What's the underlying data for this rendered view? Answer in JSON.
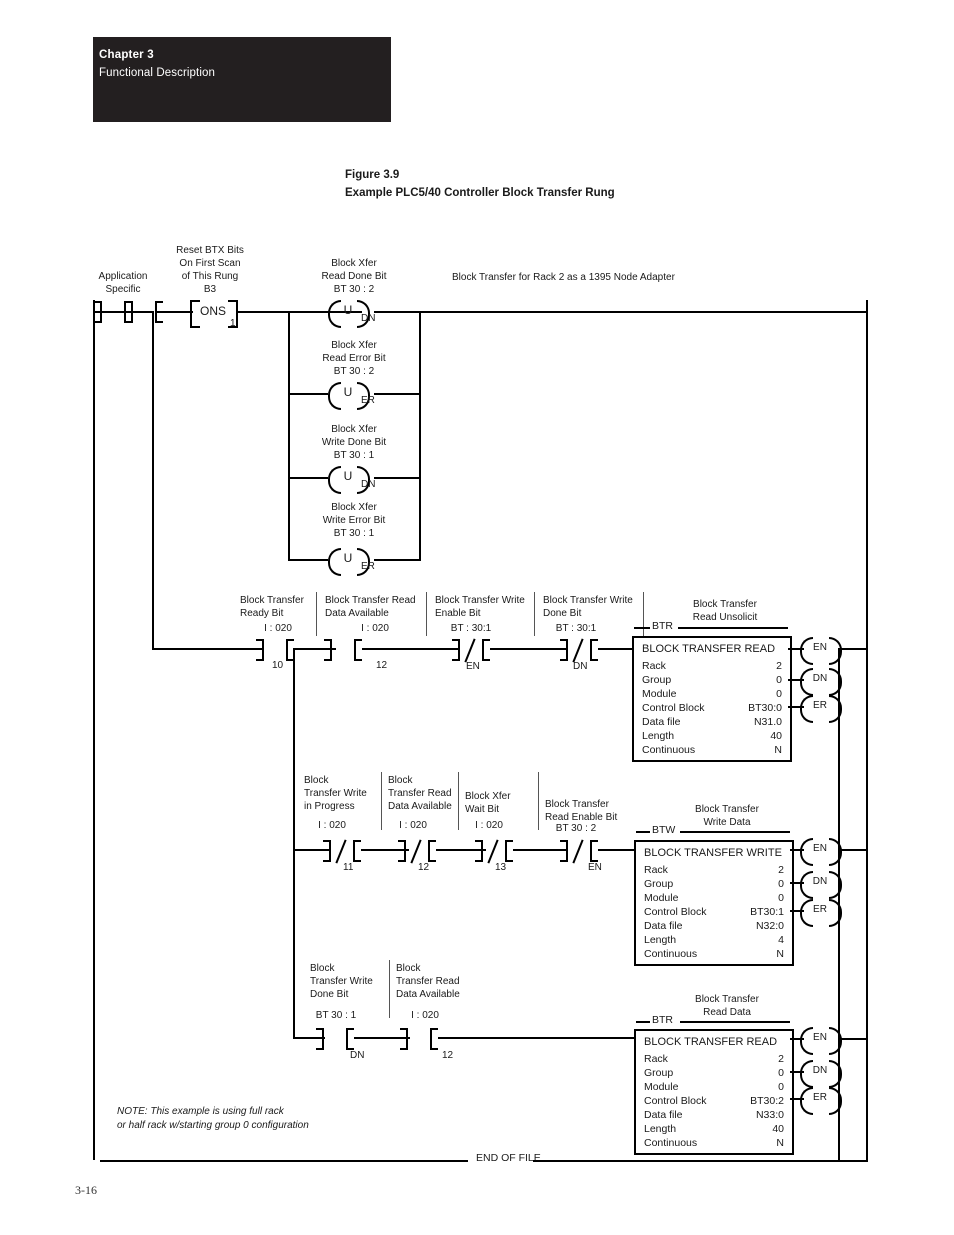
{
  "header": {
    "chapter": "Chapter 3",
    "subtitle": "Functional Description"
  },
  "figure": {
    "number": "Figure 3.9",
    "title": "Example PLC5/40 Controller Block Transfer Rung"
  },
  "page_number": "3-16",
  "note": {
    "line1": "NOTE: This example is using full rack",
    "line2": "or half rack w/starting group 0 configuration"
  },
  "end_of_file": "END OF FILE",
  "rung1": {
    "comment": "Block Transfer for Rack 2 as a 1395 Node Adapter",
    "contact1": {
      "label_line1": "Application",
      "label_line2": "Specific",
      "type": "xic"
    },
    "contact2": {
      "label_line1": "Reset BTX Bits",
      "label_line2": "On First Scan",
      "label_line3": "of This Rung",
      "address": "B3",
      "bit": "1",
      "type": "xic"
    },
    "ons": {
      "label": "ONS"
    },
    "coils": [
      {
        "comment_line1": "Block Xfer",
        "comment_line2": "Read Done Bit",
        "address": "BT 30 : 2",
        "letter": "U",
        "tag": "DN"
      },
      {
        "comment_line1": "Block Xfer",
        "comment_line2": "Read Error Bit",
        "address": "BT 30 : 2",
        "letter": "U",
        "tag": "ER"
      },
      {
        "comment_line1": "Block Xfer",
        "comment_line2": "Write Done Bit",
        "address": "BT 30 : 1",
        "letter": "U",
        "tag": "DN"
      },
      {
        "comment_line1": "Block Xfer",
        "comment_line2": "Write Error Bit",
        "address": "BT 30 : 1",
        "letter": "U",
        "tag": "ER"
      }
    ]
  },
  "rung2": {
    "contacts": [
      {
        "label_line1": "Block Transfer",
        "label_line2": "Ready Bit",
        "address": "I : 020",
        "bit": "10",
        "type": "xic"
      },
      {
        "label_line1": "Block Transfer Read",
        "label_line2": "Data Available",
        "address": "I : 020",
        "bit": "12",
        "type": "xic"
      },
      {
        "label_line1": "Block Transfer Write",
        "label_line2": "Enable Bit",
        "address": "BT : 30:1",
        "bit": "EN",
        "type": "xio"
      },
      {
        "label_line1": "Block Transfer Write",
        "label_line2": "Done Bit",
        "address": "BT : 30:1",
        "bit": "DN",
        "type": "xio"
      }
    ],
    "block": {
      "tag": "BTR",
      "comment_line1": "Block Transfer",
      "comment_line2": "Read Unsolicit",
      "title": "BLOCK TRANSFER READ",
      "rows": [
        {
          "label": "Rack",
          "value": "2"
        },
        {
          "label": "Group",
          "value": "0"
        },
        {
          "label": "Module",
          "value": "0"
        },
        {
          "label": "Control Block",
          "value": "BT30:0"
        },
        {
          "label": "Data file",
          "value": "N31.0"
        },
        {
          "label": "Length",
          "value": "40"
        },
        {
          "label": "Continuous",
          "value": "N"
        }
      ],
      "outputs": [
        "EN",
        "DN",
        "ER"
      ]
    }
  },
  "rung3": {
    "contacts": [
      {
        "label_line1": "Block",
        "label_line2": "Transfer Write",
        "label_line3": "in Progress",
        "address": "I : 020",
        "bit": "11",
        "type": "xio"
      },
      {
        "label_line1": "Block",
        "label_line2": "Transfer Read",
        "label_line3": "Data Available",
        "address": "I : 020",
        "bit": "12",
        "type": "xio"
      },
      {
        "label_line1": "Block Xfer",
        "label_line2": "Wait Bit",
        "address": "I : 020",
        "bit": "13",
        "type": "xio"
      },
      {
        "label_line1": "Block Transfer",
        "label_line2": "Read Enable Bit",
        "address": "BT 30 : 2",
        "bit": "EN",
        "type": "xio"
      }
    ],
    "block": {
      "tag": "BTW",
      "comment_line1": "Block Transfer",
      "comment_line2": "Write Data",
      "title": "BLOCK TRANSFER WRITE",
      "rows": [
        {
          "label": "Rack",
          "value": "2"
        },
        {
          "label": "Group",
          "value": "0"
        },
        {
          "label": "Module",
          "value": "0"
        },
        {
          "label": "Control Block",
          "value": "BT30:1"
        },
        {
          "label": "Data file",
          "value": "N32:0"
        },
        {
          "label": "Length",
          "value": "4"
        },
        {
          "label": "Continuous",
          "value": "N"
        }
      ],
      "outputs": [
        "EN",
        "DN",
        "ER"
      ]
    }
  },
  "rung4": {
    "contacts": [
      {
        "label_line1": "Block",
        "label_line2": "Transfer Write",
        "label_line3": "Done Bit",
        "address": "BT 30 : 1",
        "bit": "DN",
        "type": "xic"
      },
      {
        "label_line1": "Block",
        "label_line2": "Transfer Read",
        "label_line3": "Data Available",
        "address": "I : 020",
        "bit": "12",
        "type": "xic"
      }
    ],
    "block": {
      "tag": "BTR",
      "comment_line1": "Block Transfer",
      "comment_line2": "Read Data",
      "title": "BLOCK TRANSFER READ",
      "rows": [
        {
          "label": "Rack",
          "value": "2"
        },
        {
          "label": "Group",
          "value": "0"
        },
        {
          "label": "Module",
          "value": "0"
        },
        {
          "label": "Control Block",
          "value": "BT30:2"
        },
        {
          "label": "Data file",
          "value": "N33:0"
        },
        {
          "label": "Length",
          "value": "40"
        },
        {
          "label": "Continuous",
          "value": "N"
        }
      ],
      "outputs": [
        "EN",
        "DN",
        "ER"
      ]
    }
  }
}
